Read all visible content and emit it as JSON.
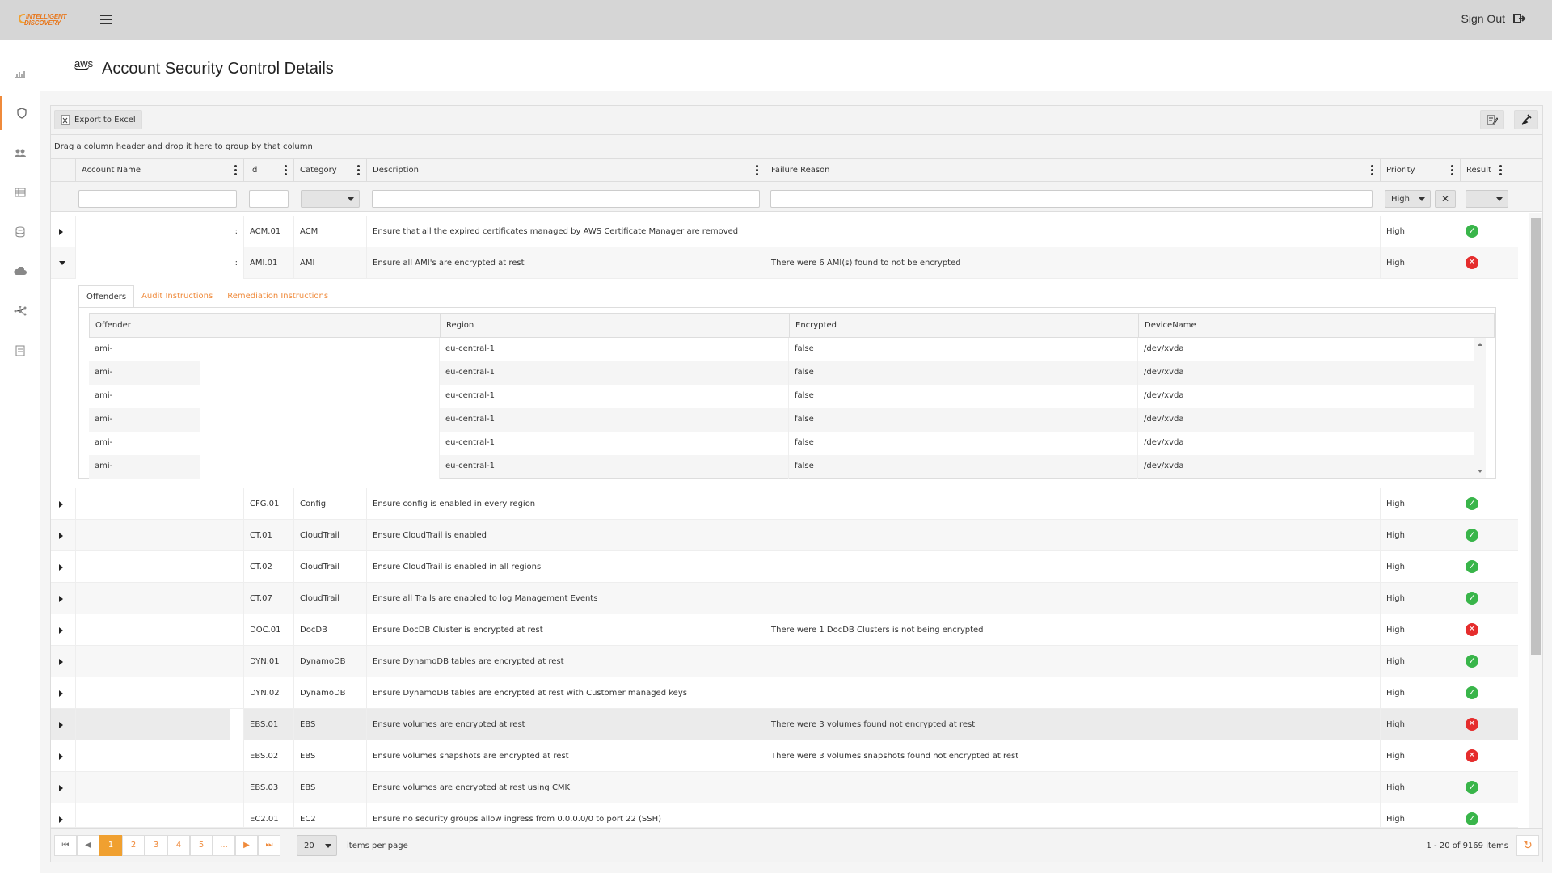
{
  "brand": {
    "logo_text": "INTELLIGENT DISCOVERY"
  },
  "topbar": {
    "signout_label": "Sign Out"
  },
  "header": {
    "aws_label": "aws",
    "title": "Account Security Control Details"
  },
  "toolbar": {
    "export_label": "Export to Excel"
  },
  "groupbar": {
    "hint": "Drag a column header and drop it here to group by that column"
  },
  "columns": {
    "account": "Account Name",
    "id": "Id",
    "category": "Category",
    "description": "Description",
    "failure": "Failure Reason",
    "priority": "Priority",
    "result": "Result"
  },
  "filters": {
    "priority_value": "High"
  },
  "rows_top": [
    {
      "account": ":",
      "id": "ACM.01",
      "category": "ACM",
      "description": "Ensure that all the expired certificates managed by AWS Certificate Manager are removed",
      "failure": "",
      "priority": "High",
      "result": "pass"
    },
    {
      "account": ":",
      "id": "AMI.01",
      "category": "AMI",
      "description": "Ensure all AMI's are encrypted at rest",
      "failure": "There were 6 AMI(s) found to not be encrypted",
      "priority": "High",
      "result": "fail"
    }
  ],
  "detail": {
    "tabs": [
      "Offenders",
      "Audit Instructions",
      "Remediation Instructions"
    ],
    "columns": {
      "offender": "Offender",
      "region": "Region",
      "encrypted": "Encrypted",
      "device": "DeviceName"
    },
    "rows": [
      {
        "offender": "ami-",
        "region": "eu-central-1",
        "encrypted": "false",
        "device": "/dev/xvda"
      },
      {
        "offender": "ami-",
        "region": "eu-central-1",
        "encrypted": "false",
        "device": "/dev/xvda"
      },
      {
        "offender": "ami-",
        "region": "eu-central-1",
        "encrypted": "false",
        "device": "/dev/xvda"
      },
      {
        "offender": "ami-",
        "region": "eu-central-1",
        "encrypted": "false",
        "device": "/dev/xvda"
      },
      {
        "offender": "ami-",
        "region": "eu-central-1",
        "encrypted": "false",
        "device": "/dev/xvda"
      },
      {
        "offender": "ami-",
        "region": "eu-central-1",
        "encrypted": "false",
        "device": "/dev/xvda"
      }
    ]
  },
  "rows": [
    {
      "id": "CFG.01",
      "category": "Config",
      "description": "Ensure config is enabled in every region",
      "failure": "",
      "priority": "High",
      "result": "pass"
    },
    {
      "id": "CT.01",
      "category": "CloudTrail",
      "description": "Ensure CloudTrail is enabled",
      "failure": "",
      "priority": "High",
      "result": "pass"
    },
    {
      "id": "CT.02",
      "category": "CloudTrail",
      "description": "Ensure CloudTrail is enabled in all regions",
      "failure": "",
      "priority": "High",
      "result": "pass"
    },
    {
      "id": "CT.07",
      "category": "CloudTrail",
      "description": "Ensure all Trails are enabled to log Management Events",
      "failure": "",
      "priority": "High",
      "result": "pass"
    },
    {
      "id": "DOC.01",
      "category": "DocDB",
      "description": "Ensure DocDB Cluster is encrypted at rest",
      "failure": "There were 1 DocDB Clusters is not being encrypted",
      "priority": "High",
      "result": "fail"
    },
    {
      "id": "DYN.01",
      "category": "DynamoDB",
      "description": "Ensure DynamoDB tables are encrypted at rest",
      "failure": "",
      "priority": "High",
      "result": "pass"
    },
    {
      "id": "DYN.02",
      "category": "DynamoDB",
      "description": "Ensure DynamoDB tables are encrypted at rest with Customer managed keys",
      "failure": "",
      "priority": "High",
      "result": "pass"
    },
    {
      "id": "EBS.01",
      "category": "EBS",
      "description": "Ensure volumes are encrypted at rest",
      "failure": "There were 3 volumes found not encrypted at rest",
      "priority": "High",
      "result": "fail"
    },
    {
      "id": "EBS.02",
      "category": "EBS",
      "description": "Ensure volumes snapshots are encrypted at rest",
      "failure": "There were 3 volumes snapshots found not encrypted at rest",
      "priority": "High",
      "result": "fail"
    },
    {
      "id": "EBS.03",
      "category": "EBS",
      "description": "Ensure volumes are encrypted at rest using CMK",
      "failure": "",
      "priority": "High",
      "result": "pass"
    },
    {
      "id": "EC2.01",
      "category": "EC2",
      "description": "Ensure no security groups allow ingress from 0.0.0.0/0 to port 22 (SSH)",
      "failure": "",
      "priority": "High",
      "result": "pass"
    }
  ],
  "pager": {
    "pages": [
      "1",
      "2",
      "3",
      "4",
      "5",
      "..."
    ],
    "page_size": "20",
    "per_page_label": "items per page",
    "summary": "1 - 20 of 9169 items"
  },
  "colors": {
    "accent": "#f0a030",
    "pass": "#39b54a",
    "fail": "#e52d2d"
  }
}
